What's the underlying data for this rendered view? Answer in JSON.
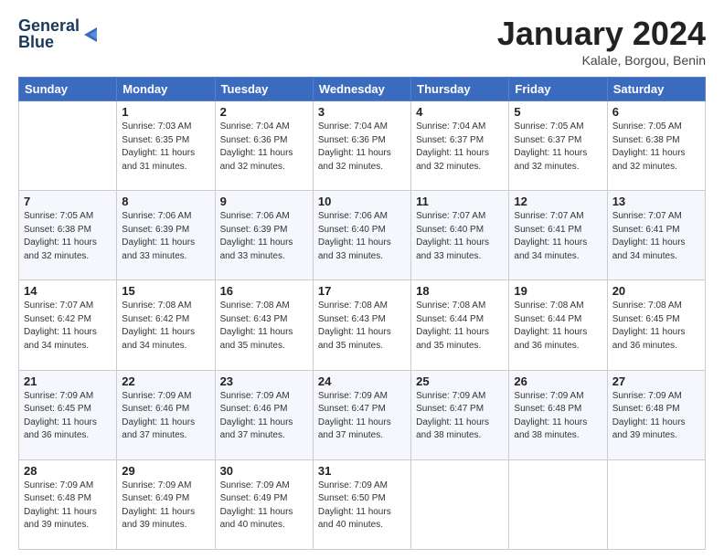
{
  "logo": {
    "line1": "General",
    "line2": "Blue"
  },
  "title": "January 2024",
  "subtitle": "Kalale, Borgou, Benin",
  "days_header": [
    "Sunday",
    "Monday",
    "Tuesday",
    "Wednesday",
    "Thursday",
    "Friday",
    "Saturday"
  ],
  "weeks": [
    [
      {
        "day": "",
        "sunrise": "",
        "sunset": "",
        "daylight": ""
      },
      {
        "day": "1",
        "sunrise": "Sunrise: 7:03 AM",
        "sunset": "Sunset: 6:35 PM",
        "daylight": "Daylight: 11 hours and 31 minutes."
      },
      {
        "day": "2",
        "sunrise": "Sunrise: 7:04 AM",
        "sunset": "Sunset: 6:36 PM",
        "daylight": "Daylight: 11 hours and 32 minutes."
      },
      {
        "day": "3",
        "sunrise": "Sunrise: 7:04 AM",
        "sunset": "Sunset: 6:36 PM",
        "daylight": "Daylight: 11 hours and 32 minutes."
      },
      {
        "day": "4",
        "sunrise": "Sunrise: 7:04 AM",
        "sunset": "Sunset: 6:37 PM",
        "daylight": "Daylight: 11 hours and 32 minutes."
      },
      {
        "day": "5",
        "sunrise": "Sunrise: 7:05 AM",
        "sunset": "Sunset: 6:37 PM",
        "daylight": "Daylight: 11 hours and 32 minutes."
      },
      {
        "day": "6",
        "sunrise": "Sunrise: 7:05 AM",
        "sunset": "Sunset: 6:38 PM",
        "daylight": "Daylight: 11 hours and 32 minutes."
      }
    ],
    [
      {
        "day": "7",
        "sunrise": "Sunrise: 7:05 AM",
        "sunset": "Sunset: 6:38 PM",
        "daylight": "Daylight: 11 hours and 32 minutes."
      },
      {
        "day": "8",
        "sunrise": "Sunrise: 7:06 AM",
        "sunset": "Sunset: 6:39 PM",
        "daylight": "Daylight: 11 hours and 33 minutes."
      },
      {
        "day": "9",
        "sunrise": "Sunrise: 7:06 AM",
        "sunset": "Sunset: 6:39 PM",
        "daylight": "Daylight: 11 hours and 33 minutes."
      },
      {
        "day": "10",
        "sunrise": "Sunrise: 7:06 AM",
        "sunset": "Sunset: 6:40 PM",
        "daylight": "Daylight: 11 hours and 33 minutes."
      },
      {
        "day": "11",
        "sunrise": "Sunrise: 7:07 AM",
        "sunset": "Sunset: 6:40 PM",
        "daylight": "Daylight: 11 hours and 33 minutes."
      },
      {
        "day": "12",
        "sunrise": "Sunrise: 7:07 AM",
        "sunset": "Sunset: 6:41 PM",
        "daylight": "Daylight: 11 hours and 34 minutes."
      },
      {
        "day": "13",
        "sunrise": "Sunrise: 7:07 AM",
        "sunset": "Sunset: 6:41 PM",
        "daylight": "Daylight: 11 hours and 34 minutes."
      }
    ],
    [
      {
        "day": "14",
        "sunrise": "Sunrise: 7:07 AM",
        "sunset": "Sunset: 6:42 PM",
        "daylight": "Daylight: 11 hours and 34 minutes."
      },
      {
        "day": "15",
        "sunrise": "Sunrise: 7:08 AM",
        "sunset": "Sunset: 6:42 PM",
        "daylight": "Daylight: 11 hours and 34 minutes."
      },
      {
        "day": "16",
        "sunrise": "Sunrise: 7:08 AM",
        "sunset": "Sunset: 6:43 PM",
        "daylight": "Daylight: 11 hours and 35 minutes."
      },
      {
        "day": "17",
        "sunrise": "Sunrise: 7:08 AM",
        "sunset": "Sunset: 6:43 PM",
        "daylight": "Daylight: 11 hours and 35 minutes."
      },
      {
        "day": "18",
        "sunrise": "Sunrise: 7:08 AM",
        "sunset": "Sunset: 6:44 PM",
        "daylight": "Daylight: 11 hours and 35 minutes."
      },
      {
        "day": "19",
        "sunrise": "Sunrise: 7:08 AM",
        "sunset": "Sunset: 6:44 PM",
        "daylight": "Daylight: 11 hours and 36 minutes."
      },
      {
        "day": "20",
        "sunrise": "Sunrise: 7:08 AM",
        "sunset": "Sunset: 6:45 PM",
        "daylight": "Daylight: 11 hours and 36 minutes."
      }
    ],
    [
      {
        "day": "21",
        "sunrise": "Sunrise: 7:09 AM",
        "sunset": "Sunset: 6:45 PM",
        "daylight": "Daylight: 11 hours and 36 minutes."
      },
      {
        "day": "22",
        "sunrise": "Sunrise: 7:09 AM",
        "sunset": "Sunset: 6:46 PM",
        "daylight": "Daylight: 11 hours and 37 minutes."
      },
      {
        "day": "23",
        "sunrise": "Sunrise: 7:09 AM",
        "sunset": "Sunset: 6:46 PM",
        "daylight": "Daylight: 11 hours and 37 minutes."
      },
      {
        "day": "24",
        "sunrise": "Sunrise: 7:09 AM",
        "sunset": "Sunset: 6:47 PM",
        "daylight": "Daylight: 11 hours and 37 minutes."
      },
      {
        "day": "25",
        "sunrise": "Sunrise: 7:09 AM",
        "sunset": "Sunset: 6:47 PM",
        "daylight": "Daylight: 11 hours and 38 minutes."
      },
      {
        "day": "26",
        "sunrise": "Sunrise: 7:09 AM",
        "sunset": "Sunset: 6:48 PM",
        "daylight": "Daylight: 11 hours and 38 minutes."
      },
      {
        "day": "27",
        "sunrise": "Sunrise: 7:09 AM",
        "sunset": "Sunset: 6:48 PM",
        "daylight": "Daylight: 11 hours and 39 minutes."
      }
    ],
    [
      {
        "day": "28",
        "sunrise": "Sunrise: 7:09 AM",
        "sunset": "Sunset: 6:48 PM",
        "daylight": "Daylight: 11 hours and 39 minutes."
      },
      {
        "day": "29",
        "sunrise": "Sunrise: 7:09 AM",
        "sunset": "Sunset: 6:49 PM",
        "daylight": "Daylight: 11 hours and 39 minutes."
      },
      {
        "day": "30",
        "sunrise": "Sunrise: 7:09 AM",
        "sunset": "Sunset: 6:49 PM",
        "daylight": "Daylight: 11 hours and 40 minutes."
      },
      {
        "day": "31",
        "sunrise": "Sunrise: 7:09 AM",
        "sunset": "Sunset: 6:50 PM",
        "daylight": "Daylight: 11 hours and 40 minutes."
      },
      {
        "day": "",
        "sunrise": "",
        "sunset": "",
        "daylight": ""
      },
      {
        "day": "",
        "sunrise": "",
        "sunset": "",
        "daylight": ""
      },
      {
        "day": "",
        "sunrise": "",
        "sunset": "",
        "daylight": ""
      }
    ]
  ]
}
